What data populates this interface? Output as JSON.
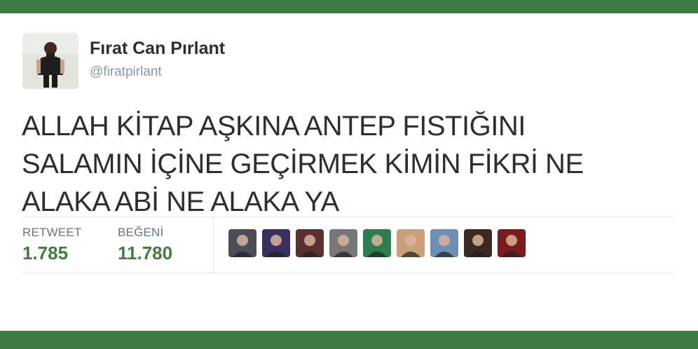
{
  "user": {
    "display_name": "Fırat Can Pırlant",
    "handle": "@firatpirlant"
  },
  "tweet": {
    "lines": [
      "ALLAH KİTAP AŞKINA ANTEP FISTIĞINI",
      "SALAMIN İÇİNE GEÇİRMEK KİMİN FİKRİ NE",
      "ALAKA ABİ NE ALAKA YA"
    ]
  },
  "stats": {
    "retweet_label": "RETWEET",
    "retweet_count": "1.785",
    "like_label": "BEĞENİ",
    "like_count": "11.780"
  },
  "liker_avatars": [
    {
      "icon": "user-avatar-icon",
      "color": "#4a4f57"
    },
    {
      "icon": "user-avatar-icon",
      "color": "#3a2f5f"
    },
    {
      "icon": "user-avatar-icon",
      "color": "#5a3030"
    },
    {
      "icon": "user-avatar-icon",
      "color": "#777777"
    },
    {
      "icon": "user-avatar-icon",
      "color": "#2e7d4f"
    },
    {
      "icon": "user-avatar-icon",
      "color": "#c9a07a"
    },
    {
      "icon": "user-avatar-icon",
      "color": "#6d8fb5"
    },
    {
      "icon": "user-avatar-icon",
      "color": "#3b2a22"
    },
    {
      "icon": "user-avatar-icon",
      "color": "#7a1c1c"
    }
  ],
  "colors": {
    "band": "#3e7a44",
    "count": "#3f7f3b",
    "label": "#66757f",
    "handle": "#8899a6",
    "text": "#292f33"
  }
}
